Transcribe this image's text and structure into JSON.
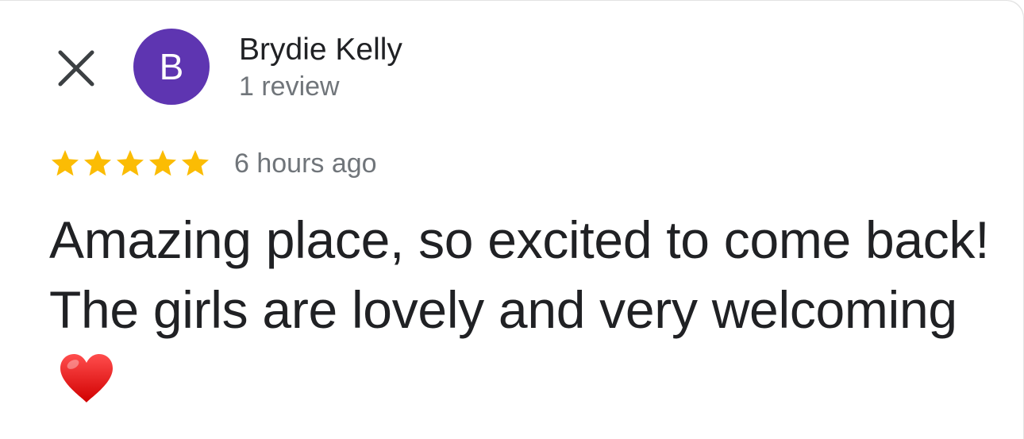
{
  "header": {
    "close_icon": "close-icon"
  },
  "reviewer": {
    "avatar_letter": "B",
    "avatar_color": "#5e35b1",
    "name": "Brydie Kelly",
    "review_count": "1 review"
  },
  "review": {
    "rating": 5,
    "rating_max": 5,
    "star_color": "#fbbc04",
    "time": "6 hours ago",
    "text": "Amazing place, so excited to come back! The girls are lovely and very welcoming",
    "emoji_icon": "red-heart-icon"
  }
}
